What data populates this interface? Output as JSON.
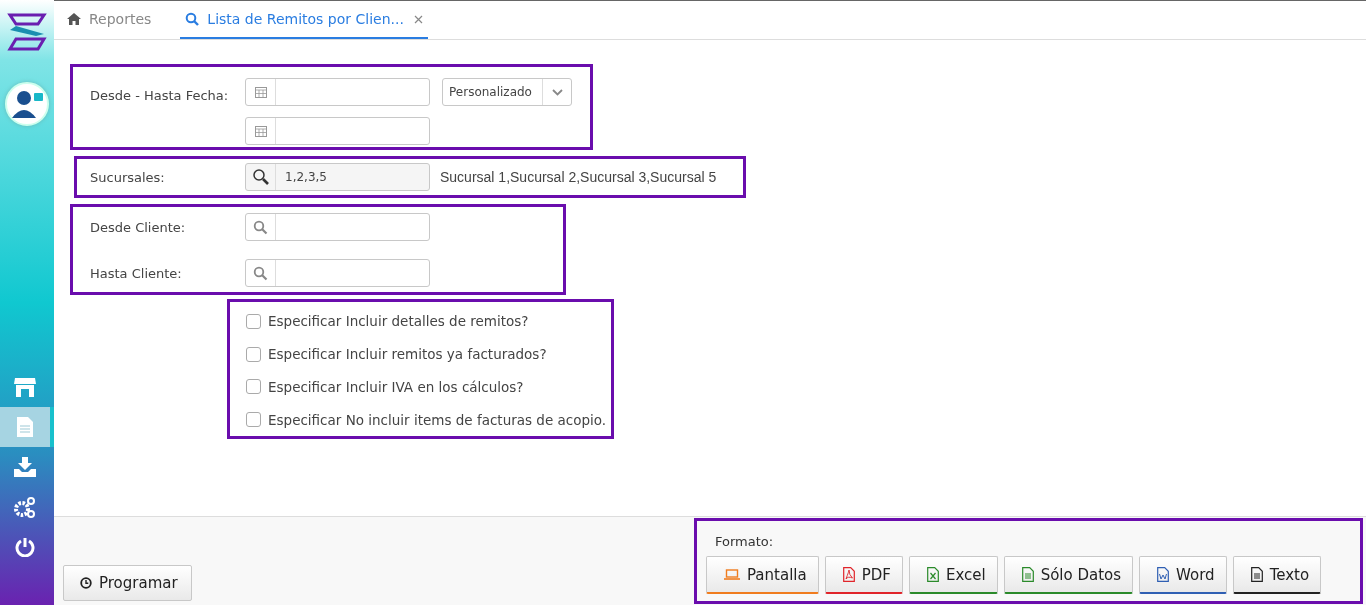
{
  "sidebar": {
    "items": [
      {
        "kind": "store",
        "selected": false
      },
      {
        "kind": "document",
        "selected": true
      },
      {
        "kind": "download",
        "selected": false
      },
      {
        "kind": "gears",
        "selected": false
      },
      {
        "kind": "power",
        "selected": false
      }
    ]
  },
  "tabs": [
    {
      "kind": "home",
      "label": "Reportes",
      "selected": false,
      "closable": false
    },
    {
      "kind": "search",
      "label": "Lista de Remitos por Clien...",
      "selected": true,
      "closable": true
    }
  ],
  "form": {
    "date_range": {
      "label": "Desde - Hasta Fecha:",
      "period": "Personalizado"
    },
    "branches": {
      "label": "Sucursales:",
      "value": "1,2,3,5",
      "names": "Sucursal 1,Sucursal 2,Sucursal 3,Sucursal 5"
    },
    "client_from": {
      "label": "Desde Cliente:"
    },
    "client_to": {
      "label": "Hasta Cliente:"
    },
    "options": [
      {
        "label": "Especificar Incluir detalles de remitos?",
        "checked": false
      },
      {
        "label": "Especificar Incluir remitos ya facturados?",
        "checked": false
      },
      {
        "label": "Especificar Incluir IVA en los cálculos?",
        "checked": false
      },
      {
        "label": "Especificar No incluir items de facturas de acopio.",
        "checked": false
      }
    ]
  },
  "footer": {
    "schedule_button": "Programar",
    "format_label": "Formato:",
    "formats": [
      {
        "kind": "screen",
        "label": "Pantalla"
      },
      {
        "kind": "pdf",
        "label": "PDF"
      },
      {
        "kind": "excel",
        "label": "Excel"
      },
      {
        "kind": "data",
        "label": "Sólo Datos"
      },
      {
        "kind": "word",
        "label": "Word"
      },
      {
        "kind": "text",
        "label": "Texto"
      }
    ]
  }
}
